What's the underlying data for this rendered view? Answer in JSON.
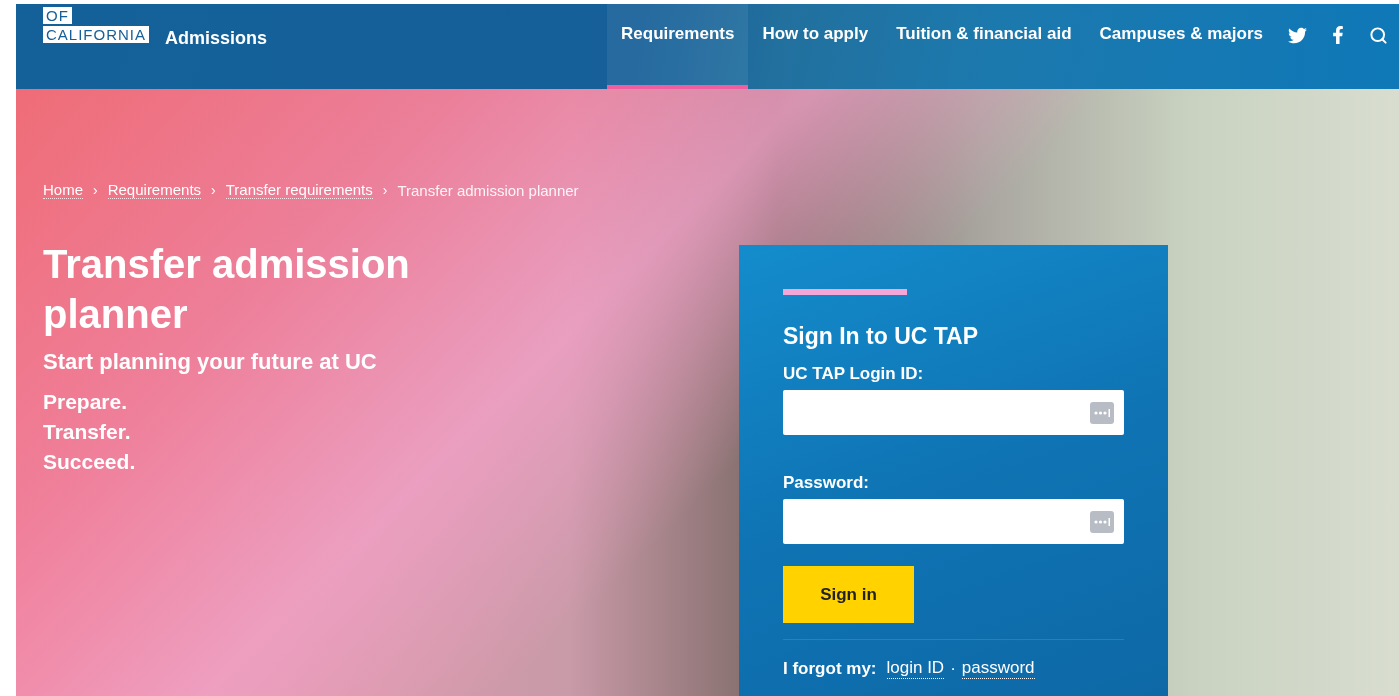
{
  "header": {
    "logo": [
      "OF",
      "CALIFORNIA"
    ],
    "title": "Admissions",
    "nav": [
      {
        "label": "Requirements",
        "selected": true
      },
      {
        "label": "How to apply",
        "selected": false
      },
      {
        "label": "Tuition & financial aid",
        "selected": false
      },
      {
        "label": "Campuses & majors",
        "selected": false
      }
    ]
  },
  "breadcrumb": {
    "items": [
      {
        "label": "Home",
        "kind": "link"
      },
      {
        "label": "Requirements",
        "kind": "link"
      },
      {
        "label": "Transfer requirements",
        "kind": "link"
      },
      {
        "label": "Transfer admission planner",
        "kind": "current"
      }
    ],
    "separators": [
      "›",
      "›",
      "›"
    ]
  },
  "hero": {
    "title": "Transfer admission planner",
    "subtitle": "Start planning your future at UC",
    "taglines": [
      "Prepare.",
      "Transfer.",
      "Succeed."
    ]
  },
  "login": {
    "title": "Sign In to UC TAP",
    "fields": [
      {
        "label": "UC TAP Login ID:"
      },
      {
        "label": "Password:"
      }
    ],
    "button": "Sign in",
    "forgot": {
      "label": "I forgot my:",
      "links": [
        "login ID",
        "password"
      ],
      "separator": "·"
    }
  }
}
